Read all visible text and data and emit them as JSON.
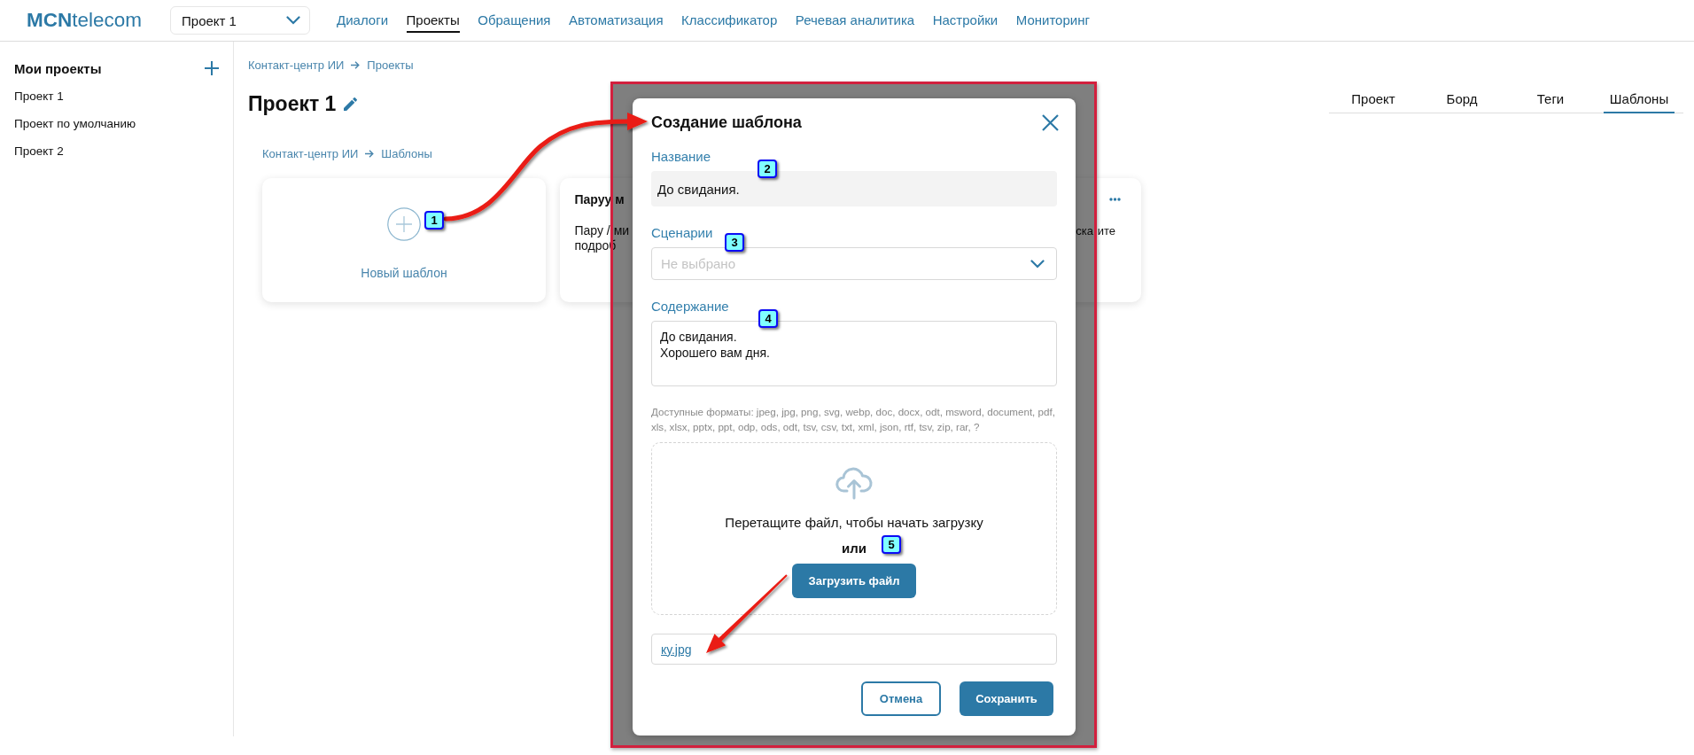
{
  "header": {
    "logo": "**MCN**telecom",
    "project_select": {
      "value": "Проект 1"
    },
    "nav": [
      {
        "label": "Диалоги",
        "selected": false
      },
      {
        "label": "Проекты",
        "selected": true
      },
      {
        "label": "Обращения",
        "selected": false
      },
      {
        "label": "Автоматизация",
        "selected": false
      },
      {
        "label": "Классификатор",
        "selected": false
      },
      {
        "label": "Речевая аналитика",
        "selected": false
      },
      {
        "label": "Настройки",
        "selected": false
      },
      {
        "label": "Мониторинг",
        "selected": false
      }
    ]
  },
  "sidebar": {
    "title": "Мои проекты",
    "items": [
      {
        "label": "Проект 1"
      },
      {
        "label": "Проект по умолчанию"
      },
      {
        "label": "Проект 2"
      }
    ]
  },
  "main": {
    "breadcrumb": [
      "Контакт-центр ИИ",
      "Проекты"
    ],
    "title": "Проект 1",
    "tabs": [
      {
        "label": "Проект",
        "selected": false
      },
      {
        "label": "Борд",
        "selected": false
      },
      {
        "label": "Теги",
        "selected": false
      },
      {
        "label": "Шаблоны",
        "selected": true
      }
    ],
    "section_breadcrumb": [
      "Контакт-центр ИИ",
      "Шаблоны"
    ],
    "cards": [
      {
        "kind": "new",
        "label": "Новый шаблон"
      },
      {
        "kind": "template",
        "title": "Паруу м",
        "text": [
          "Пару / ми",
          "подроб"
        ],
        "text_right": [
          "ска",
          "ите"
        ]
      }
    ]
  },
  "modal": {
    "title": "Создание шаблона",
    "fields": [
      {
        "kind": "input",
        "label": "Название",
        "value": "До свидания."
      },
      {
        "kind": "select",
        "label": "Сценарии",
        "placeholder": "Не выбрано"
      },
      {
        "kind": "textarea",
        "label": "Содержание",
        "value": "До свидания.\nХорошего вам дня."
      }
    ],
    "formats_hint": "Доступные форматы: jpeg, jpg, png, svg, webp, doc, docx, odt, msword, document, pdf, xls, xlsx, pptx, ppt, odp, ods, odt, tsv, csv, txt, xml, json, rtf, tsv, zip, rar, ?",
    "dropzone": {
      "text": "Перетащите файл, чтобы начать загрузку",
      "or": "или",
      "button": "Загрузить файл"
    },
    "attached_file": "ку.jpg",
    "buttons": [
      {
        "kind": "secondary",
        "label": "Отмена"
      },
      {
        "kind": "primary",
        "label": "Сохранить"
      }
    ]
  },
  "annotations": {
    "badges": [
      "1",
      "2",
      "3",
      "4",
      "5"
    ],
    "arrows": [
      {
        "kind": "curved"
      },
      {
        "kind": "straight"
      }
    ]
  }
}
